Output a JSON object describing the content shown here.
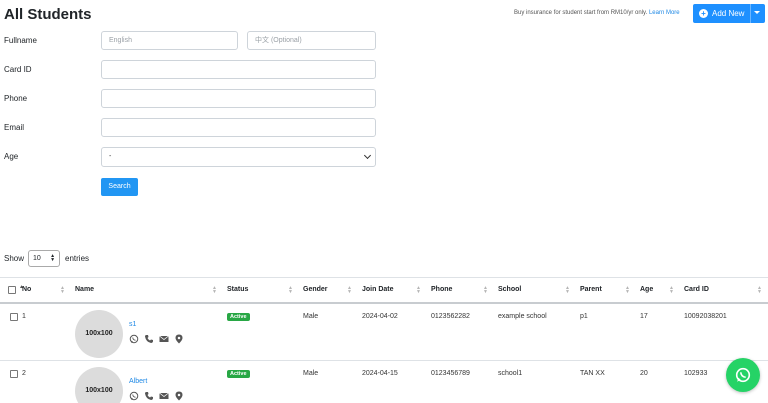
{
  "header": {
    "title": "All Students",
    "promo_text": "Buy insurance for student start from RM10/yr only.",
    "promo_link": "Learn More",
    "add_button": "Add New",
    "brand_color": "#1e90ff"
  },
  "form": {
    "fullname_label": "Fullname",
    "fullname_en_placeholder": "English",
    "fullname_cn_placeholder": "中文 (Optional)",
    "card_label": "Card ID",
    "phone_label": "Phone",
    "email_label": "Email",
    "age_label": "Age",
    "age_value": "-",
    "search_button": "Search"
  },
  "table_length": {
    "show": "Show",
    "value": "10",
    "entries": "entries"
  },
  "table": {
    "columns": [
      "No",
      "Name",
      "Status",
      "Gender",
      "Join Date",
      "Phone",
      "School",
      "Parent",
      "Age",
      "Card ID"
    ],
    "rows": [
      {
        "no": "1",
        "avatar": "100x100",
        "name": "s1",
        "status": "Active",
        "gender": "Male",
        "join_date": "2024-04-02",
        "phone": "0123562282",
        "school": "example school",
        "parent": "p1",
        "age": "17",
        "card_id": "10092038201"
      },
      {
        "no": "2",
        "avatar": "100x100",
        "name": "Albert",
        "status": "Active",
        "gender": "Male",
        "join_date": "2024-04-15",
        "phone": "0123456789",
        "school": "school1",
        "parent": "TAN XX",
        "age": "20",
        "card_id": "102933"
      }
    ]
  },
  "icons": [
    "whatsapp-icon",
    "phone-icon",
    "mail-icon",
    "location-icon"
  ],
  "colors": {
    "active_badge": "#28a745",
    "whatsapp": "#25d366",
    "link": "#1e88e5"
  }
}
